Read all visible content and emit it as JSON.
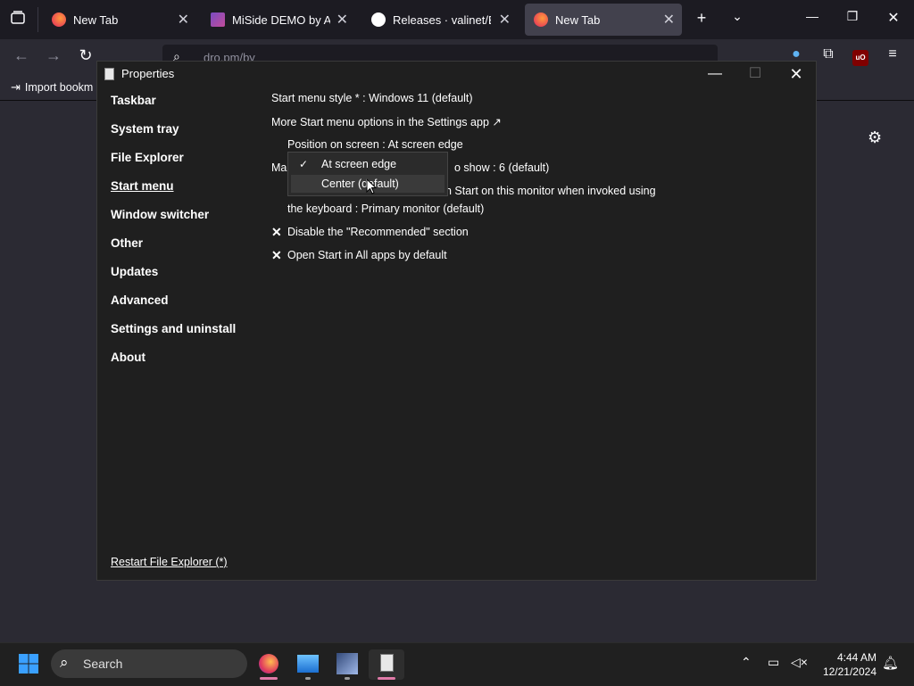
{
  "browser": {
    "tabs": [
      {
        "title": "New Tab",
        "icon": "firefox-icon",
        "active": false
      },
      {
        "title": "MiSide DEMO by Aihas",
        "icon": "game-icon",
        "active": false
      },
      {
        "title": "Releases · valinet/Explo",
        "icon": "github-icon",
        "active": false
      },
      {
        "title": "New Tab",
        "icon": "firefox-icon",
        "active": true
      }
    ],
    "url_text": "dro.pm/by",
    "bookmark_label": "Import bookm"
  },
  "window": {
    "title": "Properties",
    "nav": [
      {
        "label": "Taskbar",
        "current": false
      },
      {
        "label": "System tray",
        "current": false
      },
      {
        "label": "File Explorer",
        "current": false
      },
      {
        "label": "Start menu",
        "current": true
      },
      {
        "label": "Window switcher",
        "current": false
      },
      {
        "label": "Other",
        "current": false
      },
      {
        "label": "Updates",
        "current": false
      },
      {
        "label": "Advanced",
        "current": false
      },
      {
        "label": "Settings and uninstall",
        "current": false
      },
      {
        "label": "About",
        "current": false
      }
    ],
    "restart_link": "Restart File Explorer (*)"
  },
  "settings": {
    "start_menu_style": "Start menu style * : Windows 11 (default)",
    "more_options": "More Start menu options in the Settings app ↗",
    "position": "Position on screen : At screen edge",
    "max_prefix": "Ma",
    "max_suffix": "o show : 6 (default)",
    "monitor_line1_tail": "n Start on this monitor when invoked using",
    "monitor_line2": "the keyboard : Primary monitor (default)",
    "disable_recommended": "Disable the \"Recommended\" section",
    "open_all_apps": "Open Start in All apps by default"
  },
  "dropdown": {
    "options": [
      {
        "label": "At screen edge",
        "checked": true
      },
      {
        "label": "Center (default)",
        "checked": false
      }
    ]
  },
  "taskbar": {
    "search_placeholder": "Search",
    "time": "4:44 AM",
    "date": "12/21/2024"
  },
  "colors": {
    "window_bg": "#1f1f1f",
    "browser_bg": "#2b2a33",
    "taskbar_bg": "#202020",
    "windows_blue": "#3aa0ff"
  }
}
